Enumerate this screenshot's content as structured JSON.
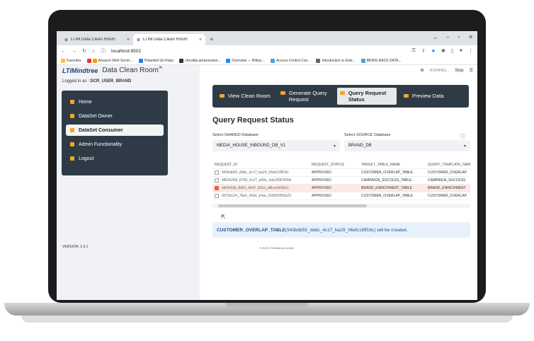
{
  "browser": {
    "tabs": [
      {
        "label": "LTIM Data Clean Room",
        "close": "×"
      },
      {
        "label": "LTIM Data Clean Room",
        "close": "×"
      }
    ],
    "new_tab": "+",
    "address": "localhost:8502",
    "bookmarks": [
      "Favorites",
      "Amazon Web Servic...",
      "Polarded Git Repo",
      "checklip.amazonaws...",
      "Overview — Bitbuc...",
      "Access Control Con...",
      "Introduction to Exte...",
      "BRING BACK DATA..."
    ]
  },
  "sidebar": {
    "logo": "LTIMindtree",
    "title": "Data Clean Room",
    "close": "×",
    "logged_prefix": "Logged in as : ",
    "logged_user": "DCR_USER_BRAND",
    "items": [
      {
        "label": "Home"
      },
      {
        "label": "DataSet Owner"
      },
      {
        "label": "DataSet Consumer"
      },
      {
        "label": "Admin Functionality"
      },
      {
        "label": "Logout"
      }
    ],
    "version": "VERSION: 1.0.1"
  },
  "main": {
    "running": "RUNNING...",
    "stop": "Stop",
    "nav": [
      {
        "label": "View Clean Room"
      },
      {
        "label": "Generate Query Request"
      },
      {
        "label": "Query Request Status"
      },
      {
        "label": "Preview Data"
      }
    ],
    "heading": "Query Request Status",
    "shared_label": "Select SHARED Database",
    "shared_value": "MEDIA_HOUSE_INBOUND_DB_V1",
    "source_label": "Select SOURCE Database",
    "source_value": "BRAND_DB",
    "table": {
      "headers": [
        "REQUEST_ID",
        "REQUEST_STATUS",
        "TARGET_TABLE_NAME",
        "QUERY_TEMPLATE_NAME"
      ],
      "rows": [
        {
          "id": "943bdb55_dddc_4c17_ba29_06efc16ff16c",
          "status": "APPROVED",
          "target": "CUSTOMER_OVERLAP_TABLE",
          "template": "CUSTOMER_OVERLAP"
        },
        {
          "id": "4802b399_8768_4c27_a49e_4ab1f587656d",
          "status": "APPROVED",
          "target": "CAMPAIGN_SUCCESS_TABLE",
          "template": "CAMPAIGN_SUCCESS"
        },
        {
          "id": "afe0c63b_8d51_4e07_811e_affcce0e56e1",
          "status": "APPROVED",
          "target": "BRAND_ENRICHMENT_TABLE",
          "template": "BRAND_ENRICHMENT"
        },
        {
          "id": "d0756c24_78a5_466e_b4ac_509206f50a23",
          "status": "APPROVED",
          "target": "CUSTOMER_OVERLAP_TABLE",
          "template": "CUSTOMER_OVERLAP"
        }
      ]
    },
    "info_table": "CUSTOMER_OVERLAP_TABLE",
    "info_rest": " (943bdb55_dddc_4c17_ba29_06efc16ff16c) will be created.",
    "footer": "© 2023 LTIMindtree Limited"
  }
}
